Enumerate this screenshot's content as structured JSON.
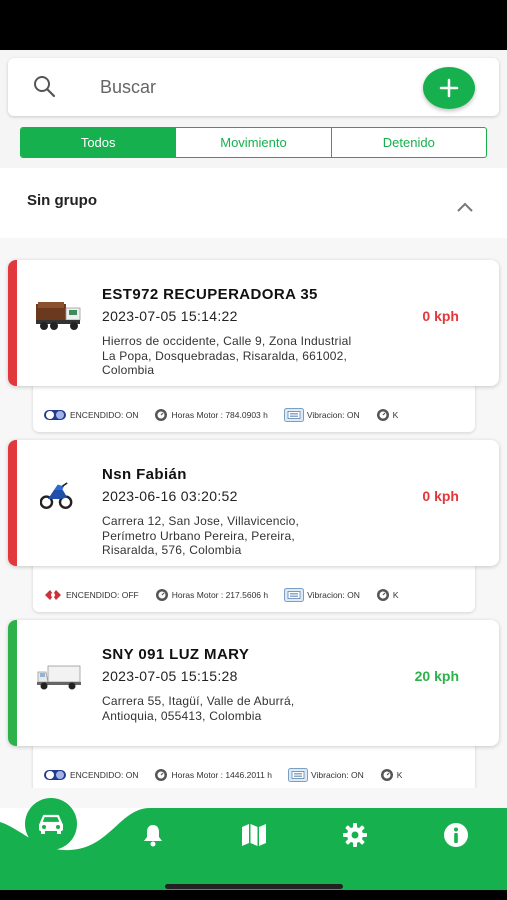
{
  "search": {
    "placeholder": "Buscar"
  },
  "tabs": [
    {
      "label": "Todos",
      "active": true
    },
    {
      "label": "Movimiento",
      "active": false
    },
    {
      "label": "Detenido",
      "active": false
    }
  ],
  "group": {
    "title": "Sin grupo"
  },
  "colors": {
    "accent": "#17b04f",
    "stopped": "#e0383c",
    "moving": "#2db24a"
  },
  "vehicles": [
    {
      "name": "EST972 RECUPERADORA  35",
      "datetime": "2023-07-05 15:14:22",
      "address": "Hierros de occidente, Calle 9, Zona Industrial La Popa, Dosquebradas, Risaralda, 661002, Colombia",
      "speed": "0 kph",
      "status": "stopped",
      "icon": "dump-truck-icon",
      "info": {
        "ignition": "ENCENDIDO: ON",
        "engine_hours": "Horas Motor : 784.0903 h",
        "vibration": "Vibracion: ON",
        "extra": "K"
      }
    },
    {
      "name": "Nsn Fabián",
      "datetime": "2023-06-16 03:20:52",
      "address": "Carrera 12, San Jose, Villavicencio, Perímetro Urbano Pereira, Pereira, Risaralda, 576, Colombia",
      "speed": "0 kph",
      "status": "stopped",
      "icon": "motorcycle-icon",
      "info": {
        "ignition": "ENCENDIDO: OFF",
        "engine_hours": "Horas Motor : 217.5606 h",
        "vibration": "Vibracion: ON",
        "extra": "K"
      }
    },
    {
      "name": "SNY 091 LUZ MARY",
      "datetime": "2023-07-05 15:15:28",
      "address": "Carrera 55, Itagüí, Valle de Aburrá, Antioquia, 055413, Colombia",
      "speed": "20 kph",
      "status": "moving",
      "icon": "box-truck-icon",
      "info": {
        "ignition": "ENCENDIDO: ON",
        "engine_hours": "Horas Motor : 1446.2011 h",
        "vibration": "Vibracion: ON",
        "extra": "K"
      }
    }
  ],
  "nav": [
    "car-icon",
    "bell-icon",
    "map-icon",
    "gear-icon",
    "info-icon"
  ]
}
